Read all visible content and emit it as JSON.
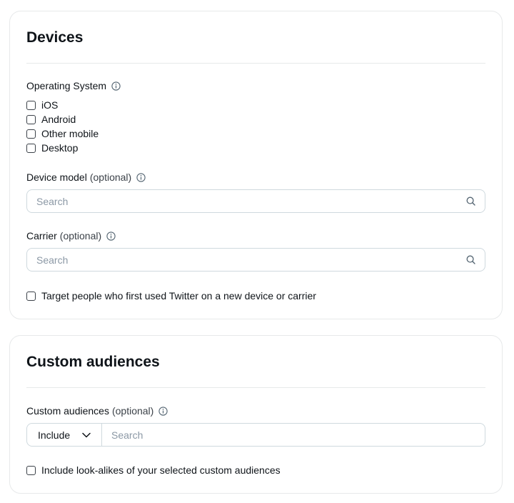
{
  "devices": {
    "title": "Devices",
    "os_label": "Operating System",
    "os_options": [
      "iOS",
      "Android",
      "Other mobile",
      "Desktop"
    ],
    "device_model_label": "Device model",
    "device_model_optional": "(optional)",
    "device_model_placeholder": "Search",
    "carrier_label": "Carrier",
    "carrier_optional": "(optional)",
    "carrier_placeholder": "Search",
    "new_device_label": "Target people who first used Twitter on a new device or carrier"
  },
  "custom_audiences": {
    "title": "Custom audiences",
    "label": "Custom audiences",
    "optional": "(optional)",
    "include_value": "Include",
    "search_placeholder": "Search",
    "lookalikes_label": "Include look-alikes of your selected custom audiences"
  },
  "icons": {
    "info": "info-icon",
    "search": "search-icon",
    "chevron": "chevron-down-icon"
  },
  "colors": {
    "border": "#cfd9de",
    "card_border": "#e7e9ea",
    "text": "#0f1419",
    "placeholder": "#8b98a5"
  }
}
